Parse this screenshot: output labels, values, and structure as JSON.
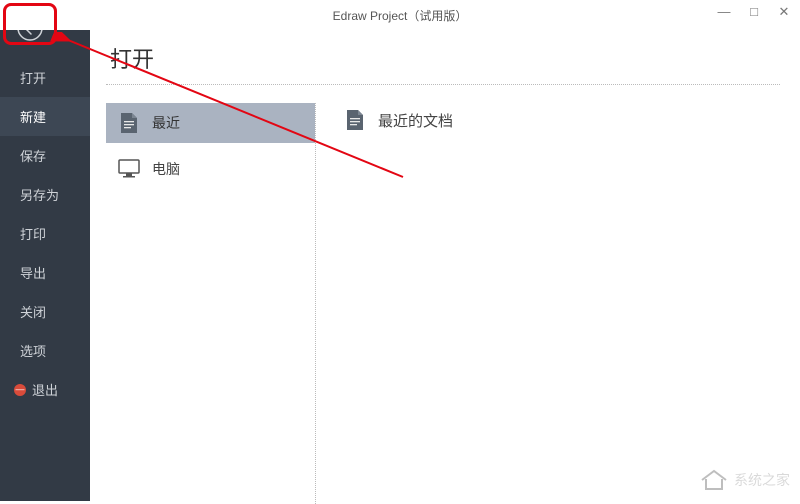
{
  "window": {
    "title": "Edraw Project（试用版）"
  },
  "sidebar": {
    "items": [
      {
        "label": "打开"
      },
      {
        "label": "新建"
      },
      {
        "label": "保存"
      },
      {
        "label": "另存为"
      },
      {
        "label": "打印"
      },
      {
        "label": "导出"
      },
      {
        "label": "关闭"
      },
      {
        "label": "选项"
      },
      {
        "label": "退出"
      }
    ]
  },
  "page": {
    "title": "打开",
    "sources": {
      "recent": "最近",
      "computer": "电脑"
    },
    "right_header": "最近的文档"
  },
  "watermark": {
    "text": "系统之家"
  }
}
